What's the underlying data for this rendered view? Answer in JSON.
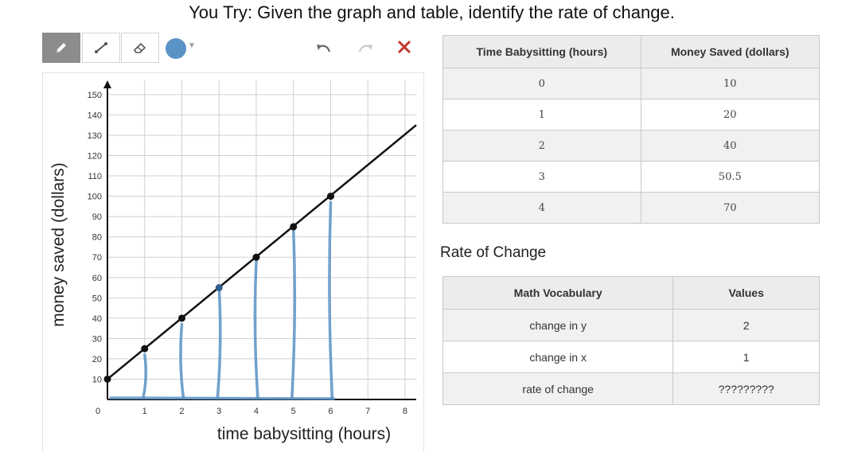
{
  "title": "You Try: Given the graph and table, identify the rate of change.",
  "toolbar": {
    "tools": [
      {
        "name": "pencil-icon",
        "active": true
      },
      {
        "name": "line-icon",
        "active": false
      },
      {
        "name": "eraser-icon",
        "active": false
      }
    ],
    "color": "#5b93c7",
    "close_color": "#c0392b"
  },
  "chart_data": {
    "type": "line",
    "xlabel": "time babysitting (hours)",
    "ylabel": "money saved (dollars)",
    "xlim": [
      0,
      8.3
    ],
    "ylim": [
      0,
      157
    ],
    "x_ticks": [
      0,
      1,
      2,
      3,
      4,
      5,
      6,
      7,
      8
    ],
    "y_ticks": [
      10,
      20,
      30,
      40,
      50,
      60,
      70,
      80,
      90,
      100,
      110,
      120,
      130,
      140,
      150
    ],
    "grid": true,
    "line": {
      "x": [
        0,
        8.3
      ],
      "y": [
        10,
        135
      ]
    },
    "points": {
      "x": [
        0,
        1,
        2,
        3,
        4,
        5,
        6
      ],
      "y": [
        10,
        25,
        40,
        55,
        70,
        85,
        100
      ]
    },
    "annotation_strokes": [
      {
        "x": 1,
        "y": 22
      },
      {
        "x": 2,
        "y": 37
      },
      {
        "x": 3,
        "y": 55
      },
      {
        "x": 4,
        "y": 68
      },
      {
        "x": 5,
        "y": 84
      },
      {
        "x": 6,
        "y": 97
      }
    ],
    "annotation_color": "#5b93c7"
  },
  "table": {
    "headers": [
      "Time Babysitting (hours)",
      "Money Saved (dollars)"
    ],
    "rows": [
      [
        "0",
        "10"
      ],
      [
        "1",
        "20"
      ],
      [
        "2",
        "40"
      ],
      [
        "3",
        "50.5"
      ],
      [
        "4",
        "70"
      ]
    ]
  },
  "rate_heading": "Rate of Change",
  "rate_table": {
    "headers": [
      "Math Vocabulary",
      "Values"
    ],
    "rows": [
      [
        "change in y",
        "2"
      ],
      [
        "change in x",
        "1"
      ],
      [
        "rate of change",
        "?????????"
      ]
    ]
  }
}
